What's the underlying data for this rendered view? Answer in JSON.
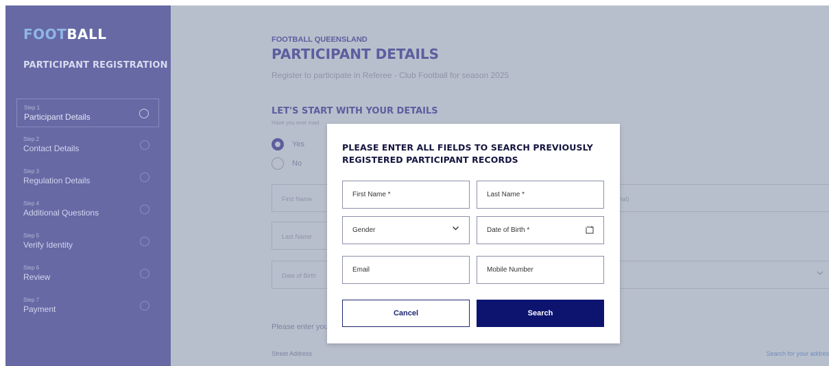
{
  "sidebar": {
    "logo_part1": "FOOT",
    "logo_part2": "BALL",
    "title": "PARTICIPANT REGISTRATION",
    "steps": [
      {
        "num": "Step 1",
        "label": "Participant Details"
      },
      {
        "num": "Step 2",
        "label": "Contact Details"
      },
      {
        "num": "Step 3",
        "label": "Regulation Details"
      },
      {
        "num": "Step 4",
        "label": "Additional Questions"
      },
      {
        "num": "Step 5",
        "label": "Verify Identity"
      },
      {
        "num": "Step 6",
        "label": "Review"
      },
      {
        "num": "Step 7",
        "label": "Payment"
      }
    ]
  },
  "main": {
    "org": "FOOTBALL QUEENSLAND",
    "title": "PARTICIPANT DETAILS",
    "subtitle": "Register to participate in Referee - Club Football for season 2025",
    "section_title": "LET'S START WITH YOUR DETAILS",
    "section_question": "Have you ever mad",
    "radio_yes": "Yes",
    "radio_no": "No",
    "field_first_name": "First Name",
    "field_optional": "tional)",
    "field_last_name": "Last Name",
    "field_dob": "Date of Birth",
    "enter_prompt": "Please enter you",
    "street_address": "Street Address",
    "search_address_link": "Search for your addres"
  },
  "modal": {
    "title": "PLEASE ENTER ALL FIELDS TO SEARCH PREVIOUSLY REGISTERED PARTICIPANT RECORDS",
    "first_name": "First Name *",
    "last_name": "Last Name *",
    "gender": "Gender",
    "dob": "Date of Birth *",
    "email": "Email",
    "mobile": "Mobile Number",
    "cancel": "Cancel",
    "search": "Search"
  },
  "colors": {
    "sidebar_bg": "#6669a4",
    "overlay_bg": "#b8bfcc",
    "primary_navy": "#0c1470",
    "heading_purple": "#5b5e9e"
  }
}
